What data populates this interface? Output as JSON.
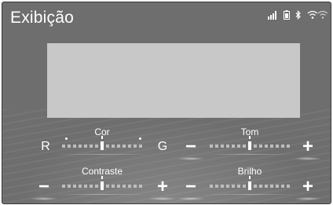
{
  "screen": {
    "title": "Exibição"
  },
  "status_icons": [
    "signal-bars-icon",
    "battery-icon",
    "bluetooth-icon",
    "wifi-icon"
  ],
  "controls": {
    "cor": {
      "label": "Cor",
      "left_label": "R",
      "right_label": "G",
      "level": 0.5
    },
    "tom": {
      "label": "Tom",
      "minus": "−",
      "plus": "+",
      "level": 0.5
    },
    "contraste": {
      "label": "Contraste",
      "minus": "−",
      "plus": "+",
      "level": 0.5
    },
    "brilho": {
      "label": "Brilho",
      "minus": "−",
      "plus": "+",
      "level": 0.5
    }
  },
  "colors": {
    "background": "#6e6e6e",
    "preview": "#c8c8c8",
    "text": "#ffffff"
  }
}
